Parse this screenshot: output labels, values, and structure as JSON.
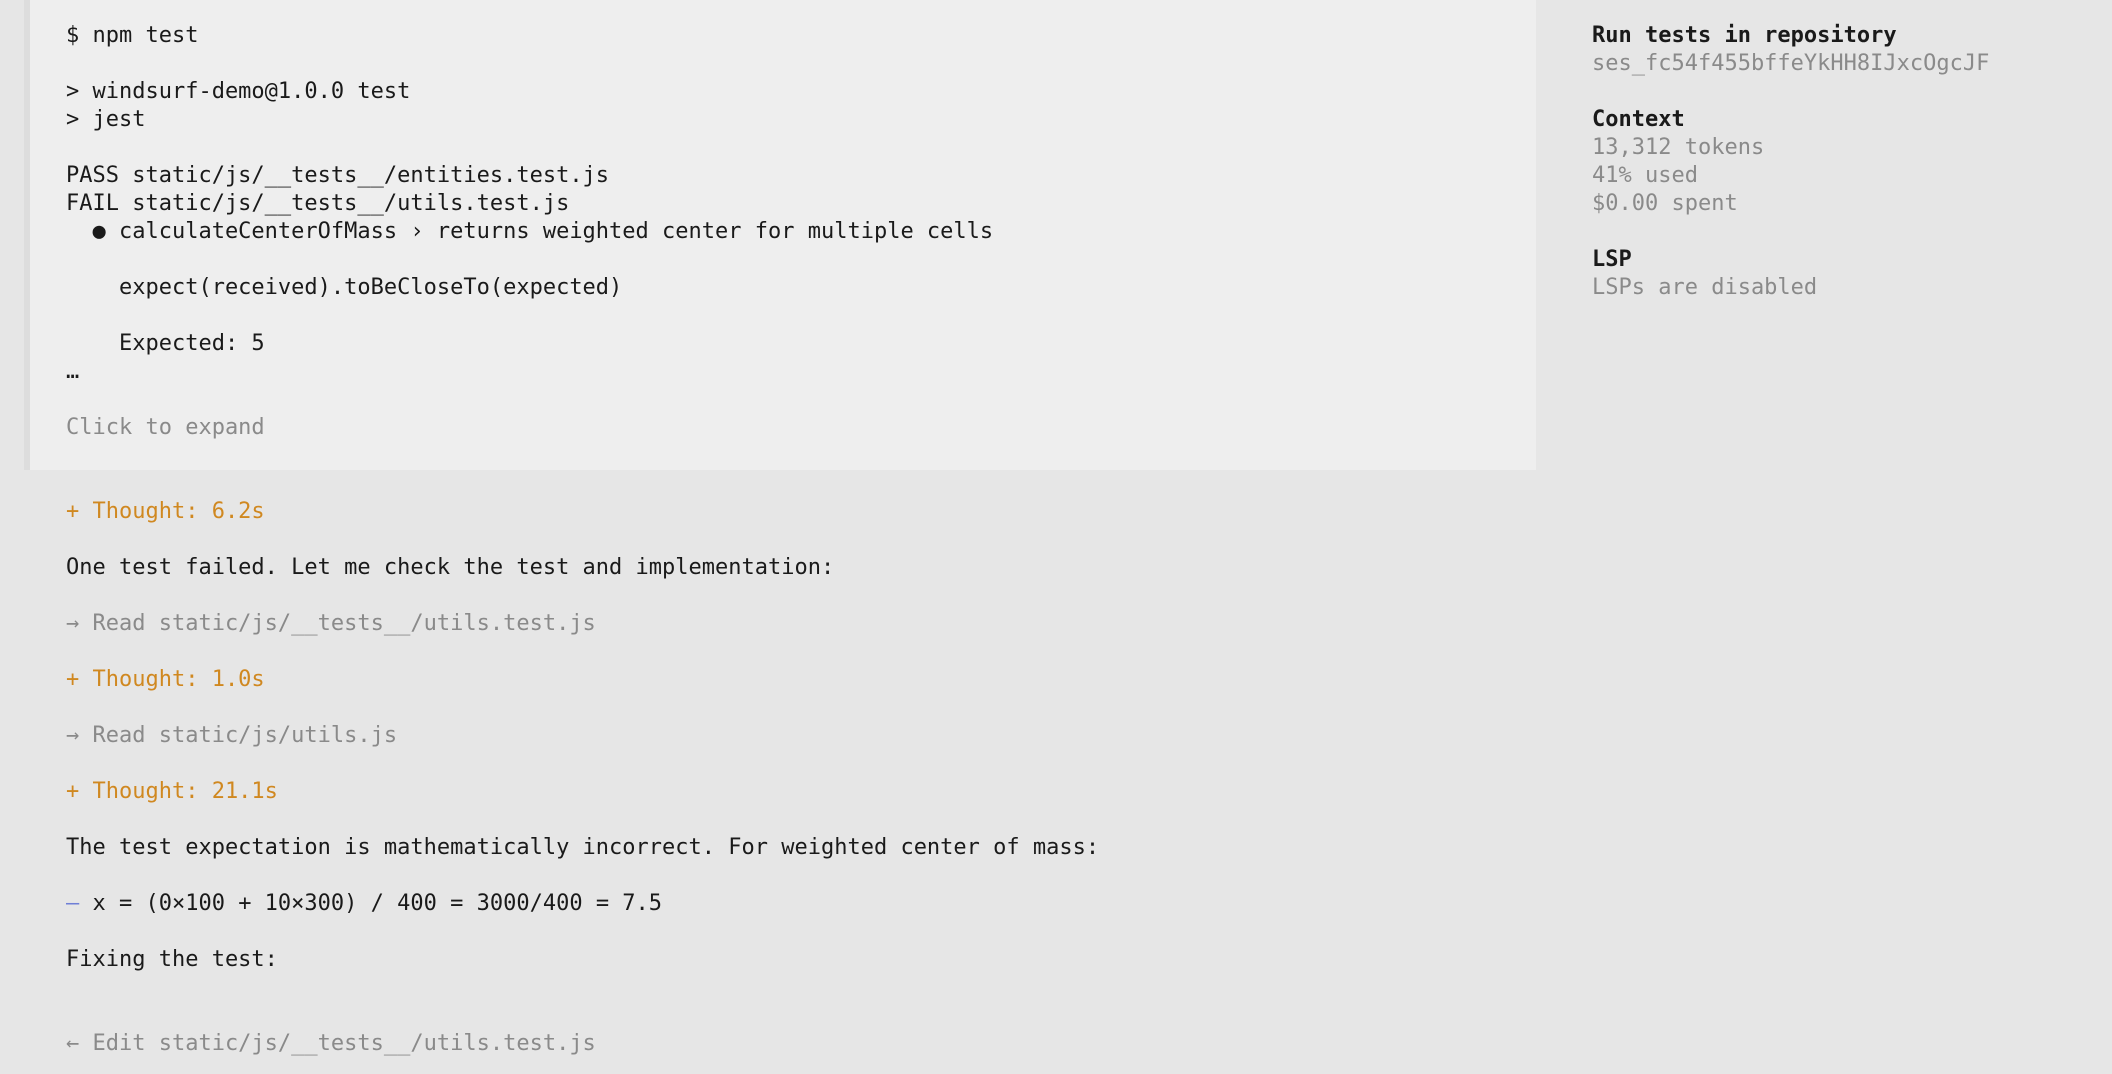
{
  "tool_output": {
    "command": "$ npm test",
    "lines": [
      "> windsurf-demo@1.0.0 test",
      "> jest",
      "PASS static/js/__tests__/entities.test.js",
      "FAIL static/js/__tests__/utils.test.js",
      "  ● calculateCenterOfMass › returns weighted center for multiple cells",
      "    expect(received).toBeCloseTo(expected)",
      "    Expected: 5",
      "…"
    ],
    "expand_hint": "Click to expand"
  },
  "transcript": {
    "thought_1": "+ Thought: 6.2s",
    "message_1": "One test failed. Let me check the test and implementation:",
    "read_1": "→ Read static/js/__tests__/utils.test.js",
    "thought_2": "+ Thought: 1.0s",
    "read_2": "→ Read static/js/utils.js",
    "thought_3": "+ Thought: 21.1s",
    "message_2": "The test expectation is mathematically incorrect. For weighted center of mass:",
    "list_marker": "–",
    "list_item": "x = (0×100 + 10×300) / 400 = 3000/400 = 7.5",
    "message_3": "Fixing the test:",
    "edit_1": "← Edit static/js/__tests__/utils.test.js"
  },
  "sidebar": {
    "session_title": "Run tests in repository",
    "session_id": "ses_fc54f455bffeYkHH8IJxcOgcJF",
    "context_heading": "Context",
    "tokens": "13,312 tokens",
    "used": "41% used",
    "spent": "$0.00 spent",
    "lsp_heading": "LSP",
    "lsp_status": "LSPs are disabled"
  },
  "colors": {
    "background": "#e6e6e6",
    "tool_block": "#eeeeee",
    "thought": "#d08820",
    "muted": "#8a8a8a",
    "list_marker": "#6f7fd6"
  }
}
